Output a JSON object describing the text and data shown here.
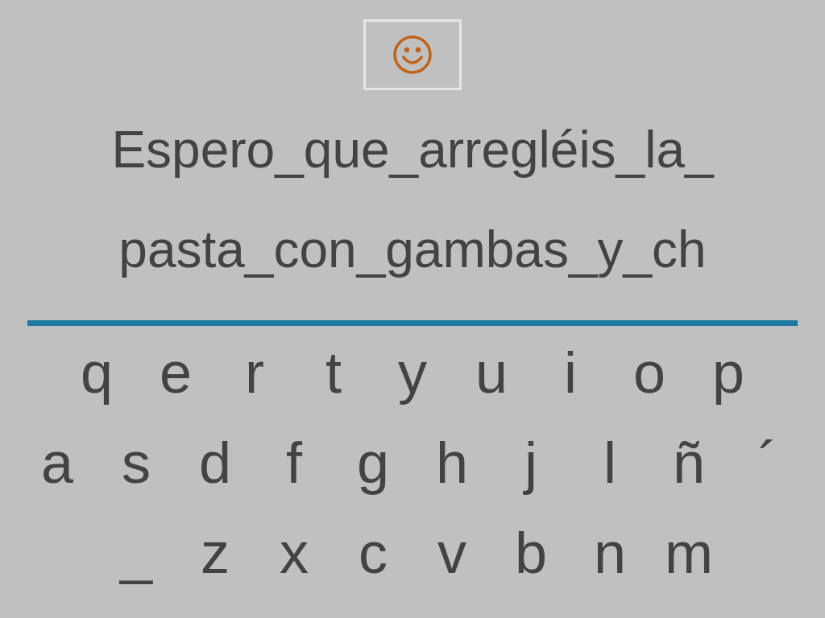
{
  "phrase_lines": [
    "Espero_que_arregléis_la_",
    "pasta_con_gambas_y_ch"
  ],
  "keyboard_rows": [
    [
      "q",
      "e",
      "r",
      "t",
      "y",
      "u",
      "i",
      "o",
      "p"
    ],
    [
      "a",
      "s",
      "d",
      "f",
      "g",
      "h",
      "j",
      "l",
      "ñ",
      "´"
    ],
    [
      "_",
      "z",
      "x",
      "c",
      "v",
      "b",
      "n",
      "m"
    ]
  ]
}
